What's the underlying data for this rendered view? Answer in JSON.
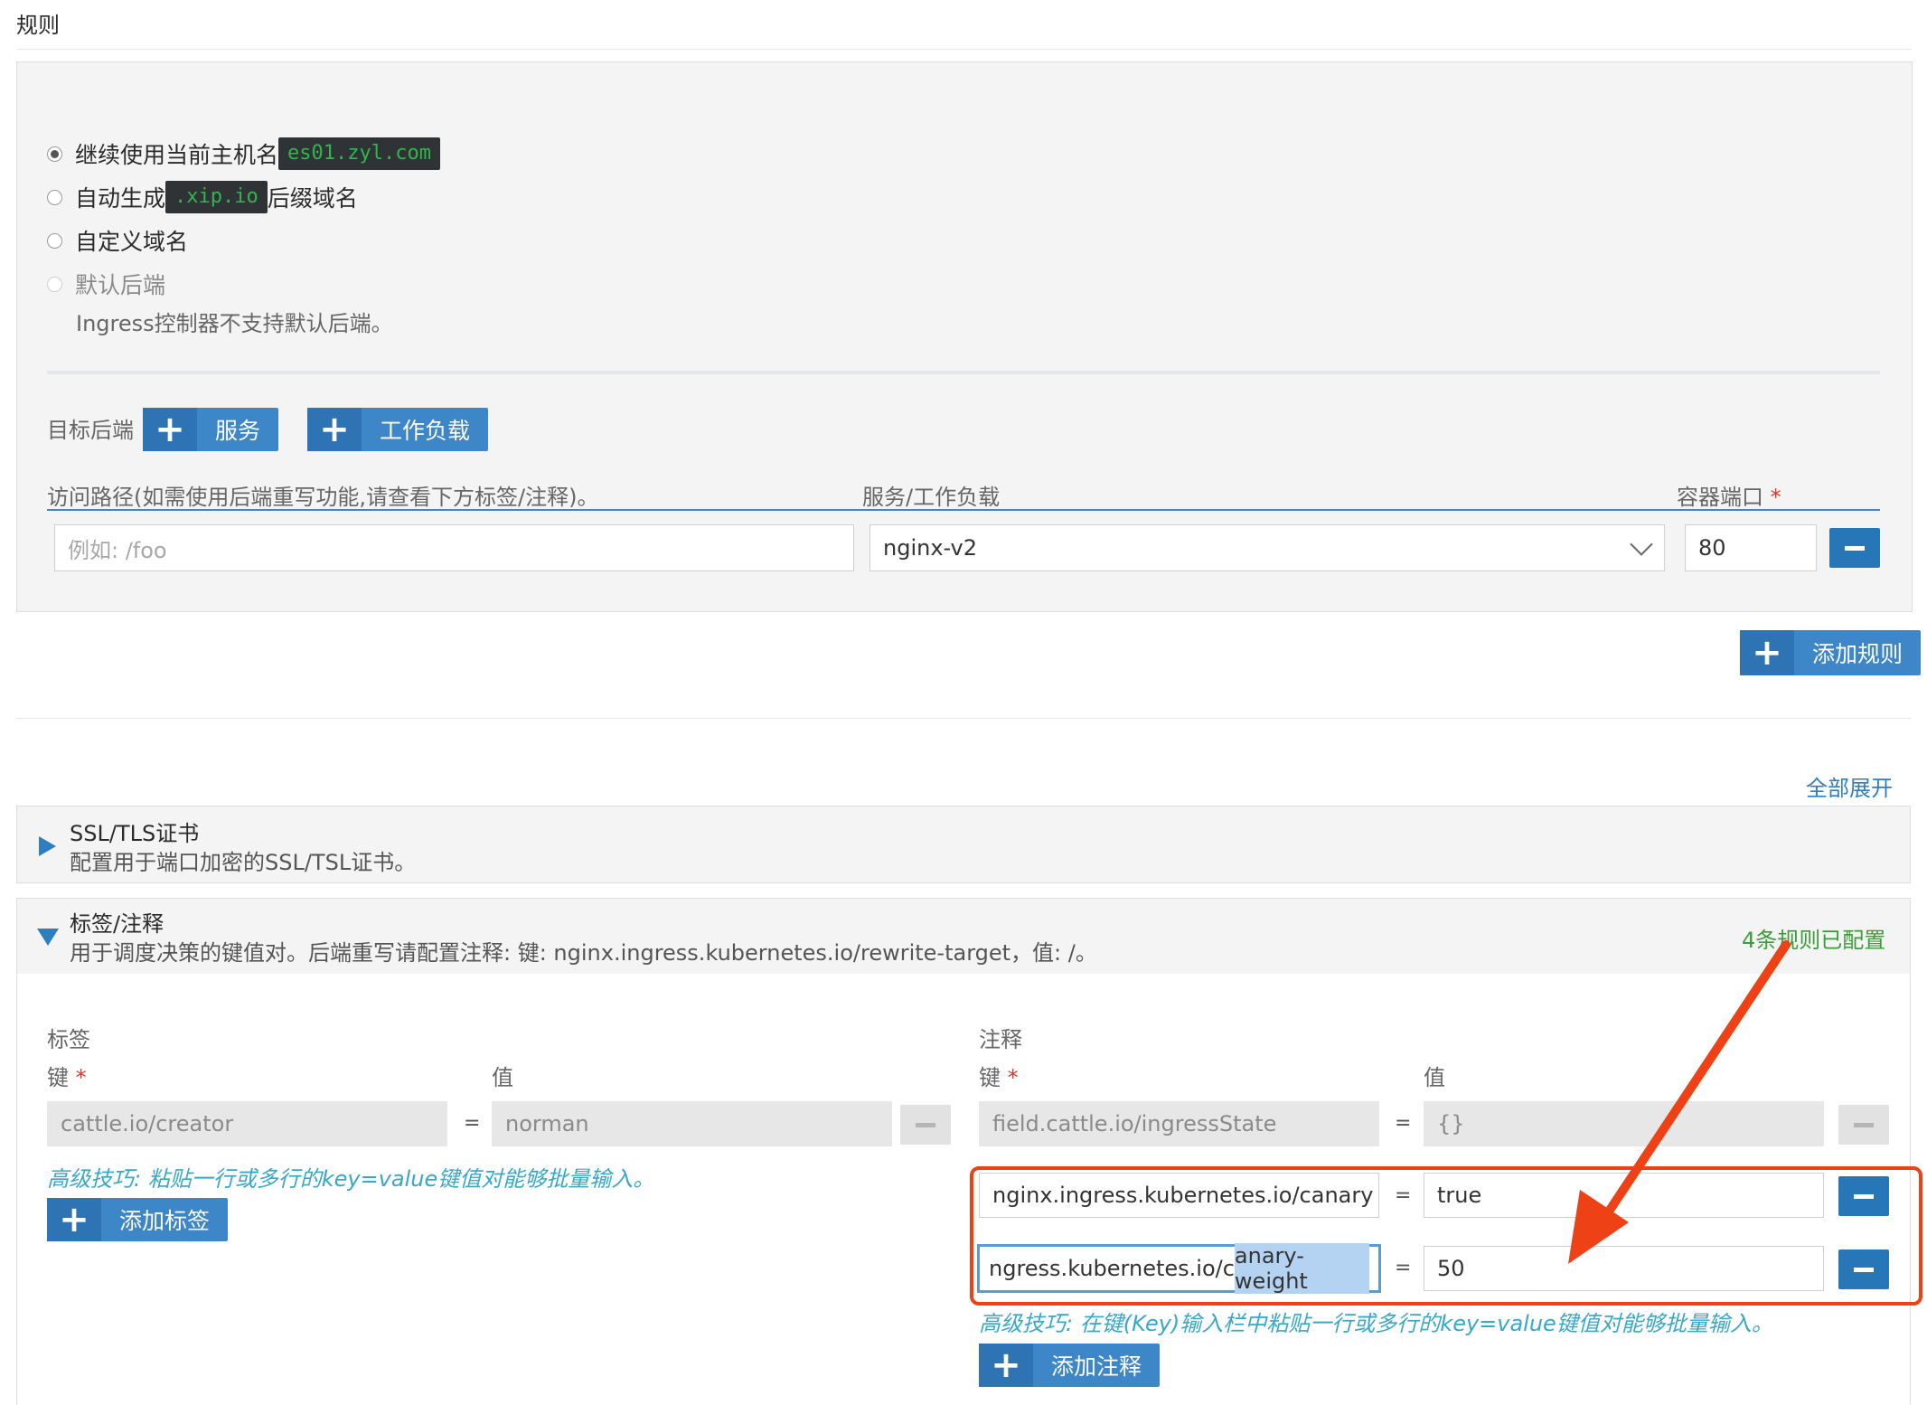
{
  "section_title": "规则",
  "hostname_options": [
    {
      "prefix": "继续使用当前主机名",
      "chip": "es01.zyl.com",
      "suffix": "",
      "selected": true,
      "disabled": false
    },
    {
      "prefix": "自动生成",
      "chip": ".xip.io",
      "suffix": "后缀域名",
      "selected": false,
      "disabled": false
    },
    {
      "prefix": "自定义域名",
      "chip": "",
      "suffix": "",
      "selected": false,
      "disabled": false
    },
    {
      "prefix": "默认后端",
      "chip": "",
      "suffix": "",
      "selected": false,
      "disabled": true
    }
  ],
  "default_backend_note": "Ingress控制器不支持默认后端。",
  "target_backend": {
    "label": "目标后端",
    "add_service_label": "服务",
    "add_workload_label": "工作负载"
  },
  "path_table": {
    "headers": {
      "path": "访问路径(如需使用后端重写功能,请查看下方标签/注释)。",
      "target": "服务/工作负载",
      "port": "容器端口",
      "port_required_mark": "*"
    },
    "row": {
      "path_placeholder": "例如: /foo",
      "target_value": "nginx-v2",
      "port_value": "80"
    }
  },
  "add_rule_label": "添加规则",
  "expand_all_label": "全部展开",
  "ssl_section": {
    "title": "SSL/TLS证书",
    "description": "配置用于端口加密的SSL/TSL证书。"
  },
  "labels_section": {
    "title": "标签/注释",
    "description": "用于调度决策的键值对。后端重写请配置注释: 键: nginx.ingress.kubernetes.io/rewrite-target，值: /。",
    "status": "4条规则已配置"
  },
  "labels": {
    "title": "标签",
    "key_header": "键",
    "value_header": "值",
    "required_mark": "*",
    "rows": [
      {
        "key": "cattle.io/creator",
        "value": "norman"
      }
    ],
    "hint": "高级技巧: 粘贴一行或多行的key=value键值对能够批量输入。",
    "add_label": "添加标签"
  },
  "annotations": {
    "title": "注释",
    "key_header": "键",
    "value_header": "值",
    "required_mark": "*",
    "rows": [
      {
        "key": "field.cattle.io/ingressState",
        "value": "{}"
      },
      {
        "key": "nginx.ingress.kubernetes.io/canary",
        "value": "true"
      },
      {
        "key_before_selection": "ngress.kubernetes.io/c",
        "key_selected": "anary-weight",
        "value": "50"
      }
    ],
    "hint": "高级技巧: 在键(Key)输入栏中粘贴一行或多行的key=value键值对能够批量输入。",
    "add_label": "添加注释"
  },
  "equals_sign": "=",
  "colors": {
    "primary": "#3d86c8",
    "primary_dark": "#2e73b3",
    "highlight_box": "#ee4216",
    "status_green": "#3a9d3a",
    "hint_teal": "#38a8c8",
    "code_green": "#32b54a"
  }
}
